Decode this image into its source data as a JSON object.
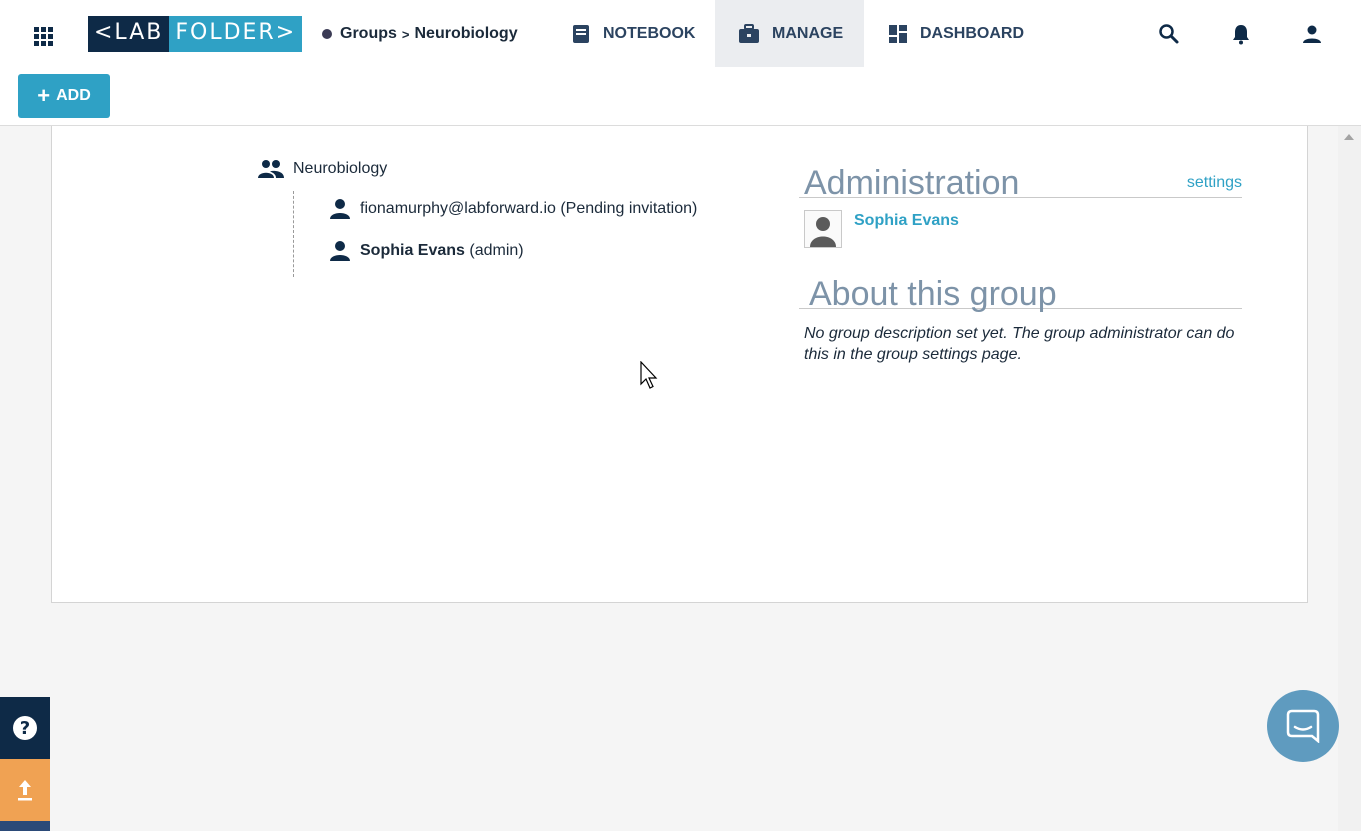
{
  "header": {
    "logo": {
      "lab": "<LAB",
      "folder": "FOLDER>"
    },
    "breadcrumb": {
      "root": "Groups",
      "separator": ">",
      "current": "Neurobiology"
    },
    "tabs": [
      {
        "label": "NOTEBOOK",
        "icon": "notebook-icon",
        "active": false
      },
      {
        "label": "MANAGE",
        "icon": "briefcase-icon",
        "active": true
      },
      {
        "label": "DASHBOARD",
        "icon": "dashboard-icon",
        "active": false
      }
    ],
    "add_label": "ADD",
    "add_plus": "+"
  },
  "group": {
    "name": "Neurobiology",
    "members": [
      {
        "name": "fionamurphy@labforward.io",
        "note": "(Pending invitation)"
      },
      {
        "name": "Sophia Evans",
        "note": "(admin)"
      }
    ]
  },
  "administration": {
    "heading": "Administration",
    "settings_link": "settings",
    "admin_name": "Sophia Evans"
  },
  "about": {
    "heading": "About this group",
    "text": "No group description set yet. The group administrator can do this in the group settings page."
  },
  "help": {
    "symbol": "?"
  },
  "colors": {
    "navy": "#0e2a47",
    "accent": "#2fa1c5",
    "heading_gray": "#7d93a8",
    "upload_orange": "#f0a253",
    "chat_blue": "#5f9bbf"
  }
}
